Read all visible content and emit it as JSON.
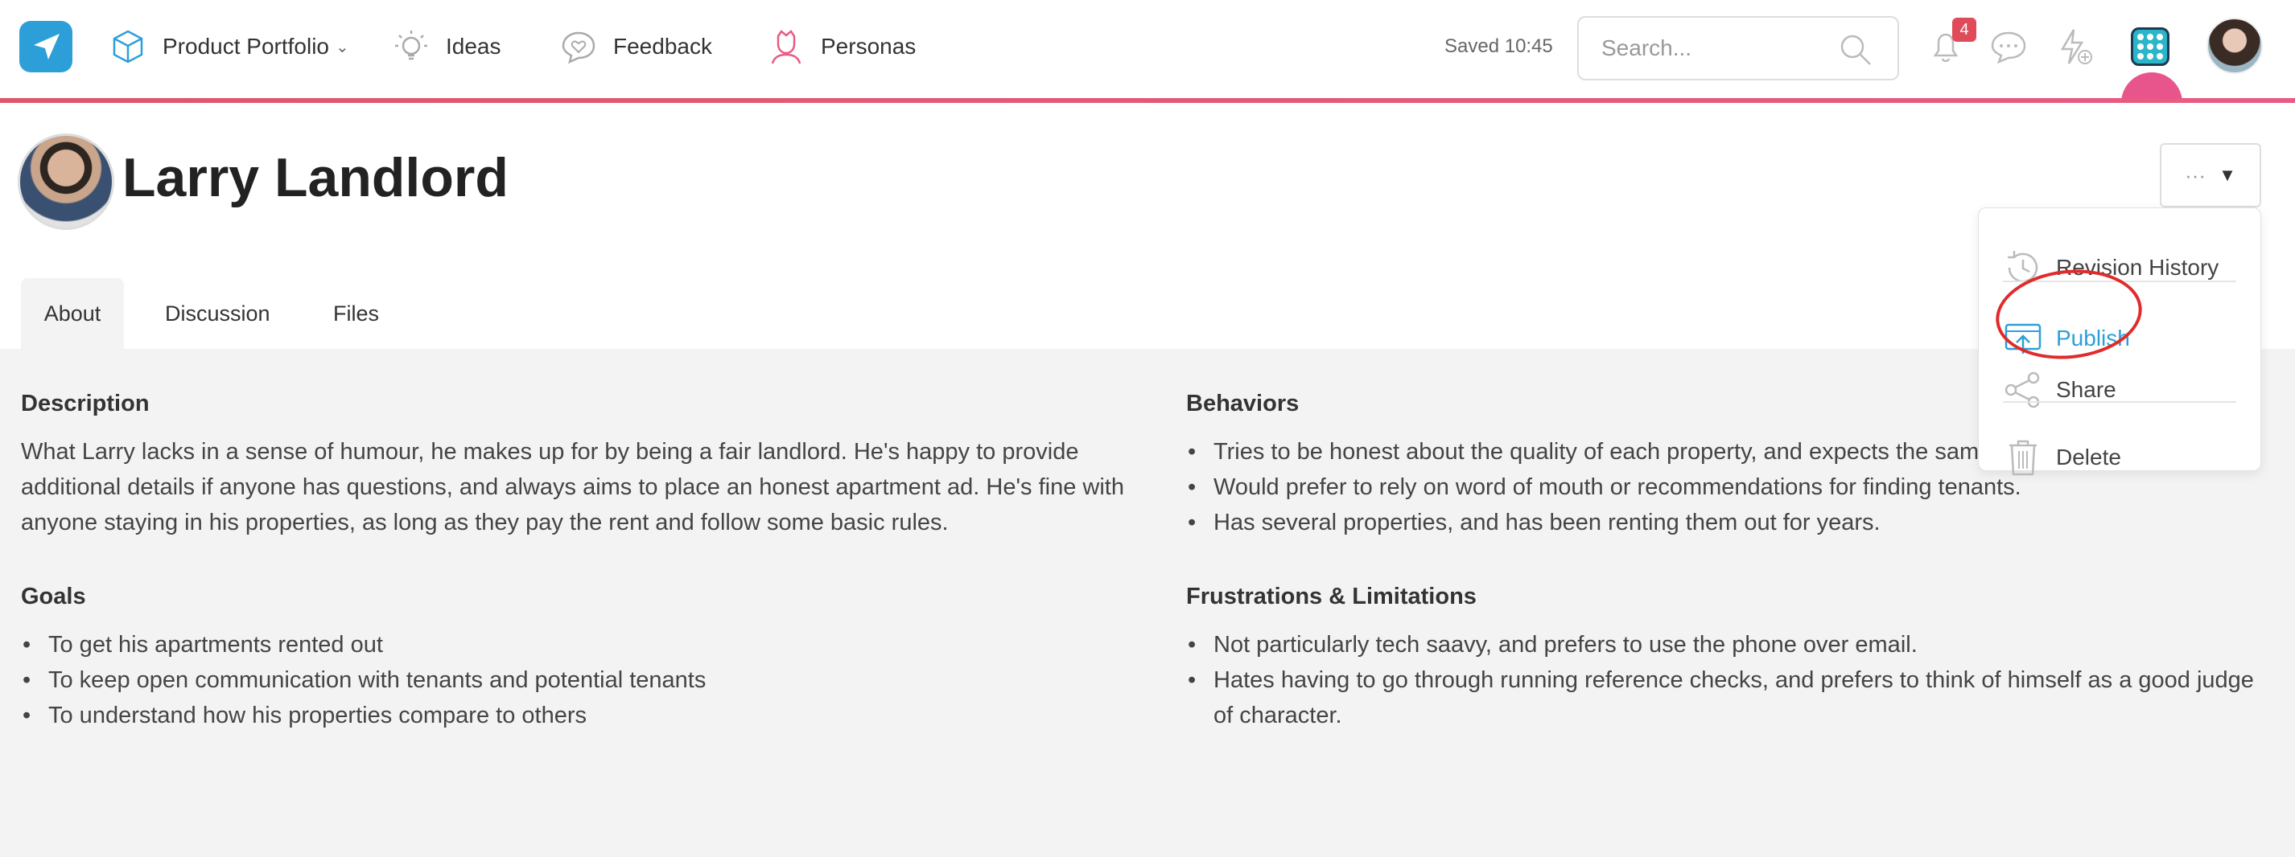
{
  "nav": {
    "items": [
      {
        "label": "Product Portfolio",
        "icon": "cube-icon"
      },
      {
        "label": "Ideas",
        "icon": "lightbulb-icon"
      },
      {
        "label": "Feedback",
        "icon": "heart-chat-icon"
      },
      {
        "label": "Personas",
        "icon": "persona-icon"
      }
    ],
    "saved_text": "Saved 10:45",
    "search_placeholder": "Search...",
    "notification_count": "4"
  },
  "persona": {
    "name": "Larry Landlord",
    "more_label": "···"
  },
  "tabs": [
    "About",
    "Discussion",
    "Files"
  ],
  "menu": {
    "revision_history": "Revision History",
    "publish": "Publish",
    "share": "Share",
    "delete": "Delete"
  },
  "content": {
    "description": {
      "title": "Description",
      "text": "What Larry lacks in a sense of humour, he makes up for by being a fair landlord. He's happy to provide additional details if anyone has questions, and always aims to place an honest apartment ad. He's fine with anyone staying in his properties, as long as they pay the rent and follow some basic rules."
    },
    "goals": {
      "title": "Goals",
      "items": [
        "To get his apartments rented out",
        "To keep open communication with tenants and potential tenants",
        "To understand how his properties compare to others"
      ]
    },
    "behaviors": {
      "title": "Behaviors",
      "items": [
        "Tries to be honest about the quality of each property, and expects the sam",
        "Would prefer to rely on word of mouth or recommendations for finding tenants.",
        "Has several properties, and has been renting them out for years."
      ]
    },
    "frustrations": {
      "title": "Frustrations & Limitations",
      "items": [
        "Not particularly tech saavy, and prefers to use the phone over email.",
        "Hates having to go through running reference checks, and prefers to think of himself as a good judge of character."
      ]
    }
  },
  "colors": {
    "accent_blue": "#2d9fd8",
    "accent_pink": "#e85b83",
    "badge_red": "#e04b59",
    "annotation_red": "#e02b2b"
  }
}
